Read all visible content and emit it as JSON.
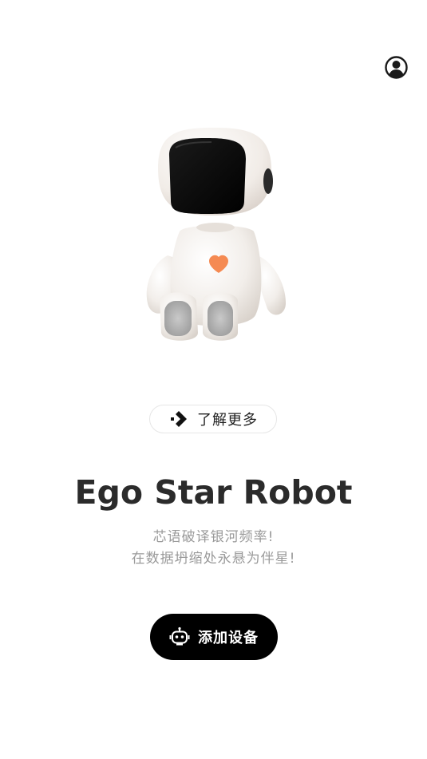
{
  "header": {
    "profile_icon": "user-circle-icon"
  },
  "hero": {
    "robot_image": "robot-illustration",
    "heart_color": "#f58a52"
  },
  "learn_more": {
    "icon": "arrow-diamond-icon",
    "label": "了解更多"
  },
  "title": "Ego Star Robot",
  "subtitle": {
    "line1": "芯语破译银河频率!",
    "line2": "在数据坍缩处永悬为伴星!"
  },
  "add_device": {
    "icon": "robot-head-icon",
    "label": "添加设备"
  },
  "colors": {
    "primary_button_bg": "#000000",
    "title_text": "#2b2b2b",
    "subtitle_text": "#9a9a9a"
  }
}
